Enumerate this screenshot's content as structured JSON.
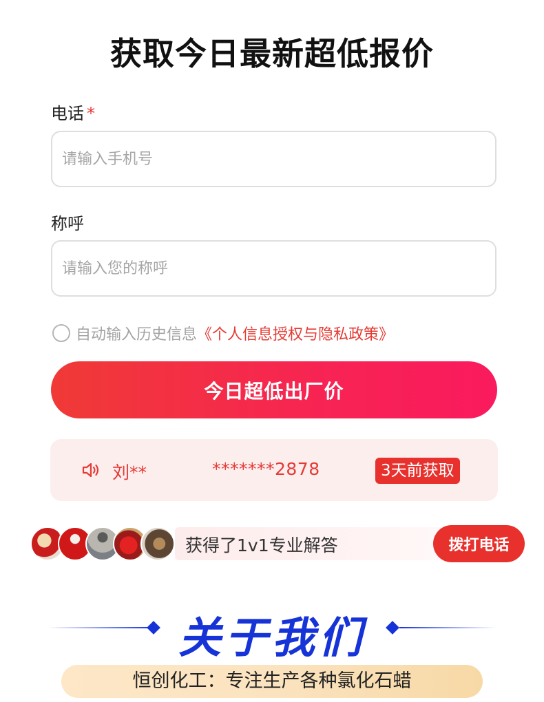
{
  "title": "获取今日最新超低报价",
  "form": {
    "phone_label": "电话",
    "required_mark": "*",
    "phone_placeholder": "请输入手机号",
    "name_label": "称呼",
    "name_placeholder": "请输入您的称呼",
    "consent_text": "自动输入历史信息",
    "policy_link": "《个人信息授权与隐私政策》",
    "submit_label": "今日超低出厂价"
  },
  "ticker": {
    "icon": "speaker-icon",
    "name": "刘**",
    "phone": "*******2878",
    "badge": "3天前获取"
  },
  "consult": {
    "avatar_count": 5,
    "text": "获得了1v1专业解答",
    "call_label": "拨打电话"
  },
  "about": {
    "heading": "关于我们",
    "tagline": "恒创化工：专注生产各种氯化石蜡"
  },
  "colors": {
    "accent_red": "#e8302d",
    "brand_blue": "#1633d8",
    "cta_gradient_start": "#f03a36",
    "cta_gradient_end": "#fa1a5e"
  }
}
